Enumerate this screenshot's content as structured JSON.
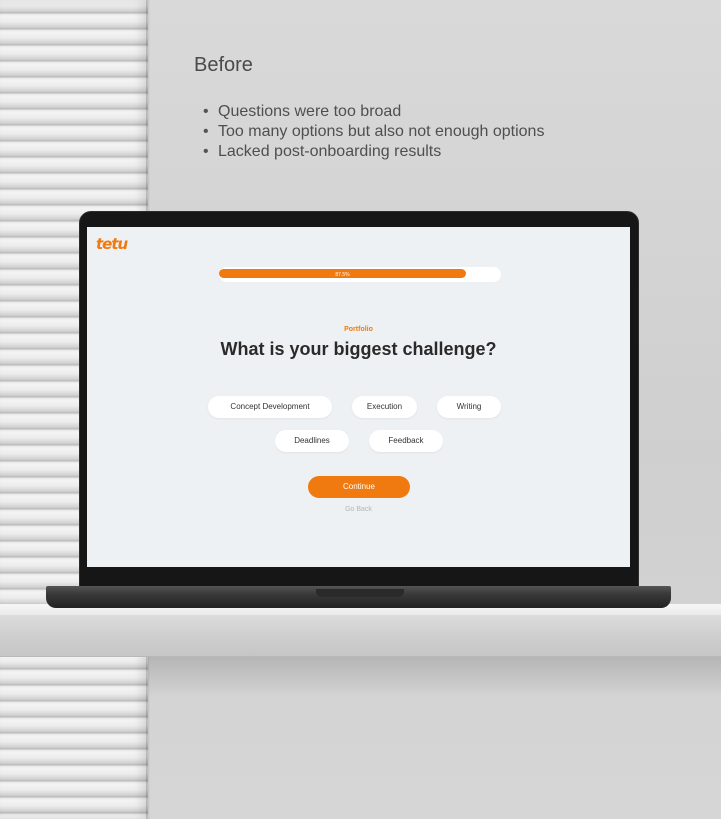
{
  "caption": {
    "title": "Before",
    "bullets": [
      "Questions were too broad",
      "Too many options but also not enough options",
      "Lacked post-onboarding results"
    ]
  },
  "app": {
    "logo_text": "tetu",
    "progress": {
      "label": "87.5%",
      "value": 0.875
    },
    "section_label": "Portfolio",
    "question": "What is your biggest challenge?",
    "options": [
      "Concept Development",
      "Execution",
      "Writing",
      "Deadlines",
      "Feedback"
    ],
    "continue_label": "Continue",
    "go_back_label": "Go Back"
  },
  "colors": {
    "accent": "#f07a10",
    "screen_bg": "#eef1f3",
    "heading": "#2a2a2a"
  }
}
